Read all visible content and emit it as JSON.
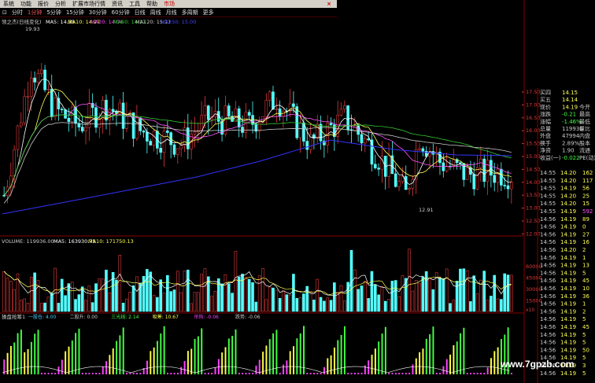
{
  "menu": {
    "items": [
      "系统",
      "功能",
      "报价",
      "分析",
      "扩展市场行情",
      "资讯",
      "工具",
      "帮助"
    ],
    "active": "市场",
    "close_glyph": "×"
  },
  "periods": {
    "lead": "⊡",
    "items": [
      "分时",
      "1分钟",
      "5分钟",
      "15分钟",
      "30分钟",
      "60分钟",
      "日线",
      "周线",
      "月线",
      "多周期",
      "更多"
    ],
    "selected": "1分钟"
  },
  "main_legend": {
    "name": "领之杰(日线变化)",
    "ma5": "MA5: 14.35",
    "ma10": "MA10: 14.27",
    "ma20": "MA20: 14.04",
    "ma60": "MA60: 14.17",
    "ma120": "MA120: 15.11",
    "ma250": "MA250: 15.00"
  },
  "price_annotations": {
    "high": "19.93",
    "low": "12.91"
  },
  "price_axis": [
    "17.50",
    "17.00",
    "16.50",
    "16.00",
    "15.50",
    "15.00",
    "14.50",
    "14.00",
    "13.50",
    "13.00",
    "12.50",
    "12.00"
  ],
  "volume_legend": {
    "name": "VOLUME: 119936.00",
    "ma5": "MA5: 163930.75",
    "ma10": "MA10: 171750.13"
  },
  "volume_axis": [
    "60000",
    "45000",
    "30000",
    "15000"
  ],
  "volume_unit": "x10",
  "indicator_legend": {
    "name": "操盘抢筹1",
    "items": [
      {
        "text": "一股仓: 4.00",
        "color": "#4cf"
      },
      {
        "text": "二股升: 0.00",
        "color": "#ccc"
      },
      {
        "text": "三光线: 2.14",
        "color": "#4f4"
      },
      {
        "text": "吸筹: 10.67",
        "color": "#ff4"
      },
      {
        "text": "吊钩: -0.06",
        "color": "#f4f"
      },
      {
        "text": "跌势: -0.06",
        "color": "#ccc"
      }
    ]
  },
  "quote_panel": [
    {
      "label": "买四",
      "value": "14.15",
      "extra": ""
    },
    {
      "label": "买五",
      "value": "14.14",
      "extra": ""
    },
    {
      "label": "现价",
      "value": "14.19",
      "extra": "今开"
    },
    {
      "label": "涨跌",
      "value": "-0.21",
      "extra": "最高"
    },
    {
      "label": "涨幅",
      "value": "-1.46%",
      "extra": "最低"
    },
    {
      "label": "总量",
      "value": "119936",
      "extra": "量比"
    },
    {
      "label": "外盘",
      "value": "47994",
      "extra": "内盘"
    },
    {
      "label": "换手",
      "value": "2.89%",
      "extra": "股本"
    },
    {
      "label": "净资",
      "value": "1.90",
      "extra": "流通"
    },
    {
      "label": "收益(一)",
      "value": "-0.022",
      "extra": "PE(动)"
    }
  ],
  "ticks": [
    {
      "time": "14:55",
      "price": "14.20",
      "vol": "162"
    },
    {
      "time": "14:55",
      "price": "14.20",
      "vol": "117"
    },
    {
      "time": "14:55",
      "price": "14.19",
      "vol": "56"
    },
    {
      "time": "14:55",
      "price": "14.20",
      "vol": "25"
    },
    {
      "time": "14:55",
      "price": "14.20",
      "vol": "15"
    },
    {
      "time": "14:55",
      "price": "14.19",
      "vol": "592"
    },
    {
      "time": "14:56",
      "price": "14.19",
      "vol": "89"
    },
    {
      "time": "14:56",
      "price": "14.19",
      "vol": "0"
    },
    {
      "time": "14:56",
      "price": "14.19",
      "vol": "27"
    },
    {
      "time": "14:56",
      "price": "14.19",
      "vol": "16"
    },
    {
      "time": "14:56",
      "price": "14.20",
      "vol": "2"
    },
    {
      "time": "14:56",
      "price": "14.19",
      "vol": "1"
    },
    {
      "time": "14:56",
      "price": "14.19",
      "vol": "13"
    },
    {
      "time": "14:56",
      "price": "14.19",
      "vol": "5"
    },
    {
      "time": "14:56",
      "price": "14.19",
      "vol": "45"
    },
    {
      "time": "14:56",
      "price": "14.19",
      "vol": "10"
    },
    {
      "time": "14:56",
      "price": "14.19",
      "vol": "36"
    },
    {
      "time": "14:56",
      "price": "14.19",
      "vol": "1"
    },
    {
      "time": "14:56",
      "price": "14.19",
      "vol": "2"
    },
    {
      "time": "14:56",
      "price": "14.19",
      "vol": "5"
    },
    {
      "time": "14:56",
      "price": "14.19",
      "vol": "45"
    },
    {
      "time": "14:56",
      "price": "14.19",
      "vol": "5"
    },
    {
      "time": "14:56",
      "price": "14.19",
      "vol": "5"
    },
    {
      "time": "14:56",
      "price": "14.19",
      "vol": "50"
    },
    {
      "time": "14:56",
      "price": "14.19",
      "vol": "5"
    },
    {
      "time": "14:56",
      "price": "14.19",
      "vol": "3"
    },
    {
      "time": "14:56",
      "price": "14.19",
      "vol": "5"
    }
  ],
  "watermark": "www.7gpzb.com",
  "colors": {
    "up": "#e03a3a",
    "down": "#54ffff",
    "ma5": "#ffffff",
    "ma10": "#ffff55",
    "ma20": "#ff55ff",
    "ma60": "#33cc33",
    "ma120": "#cccccc",
    "ma250": "#3333ff"
  }
}
